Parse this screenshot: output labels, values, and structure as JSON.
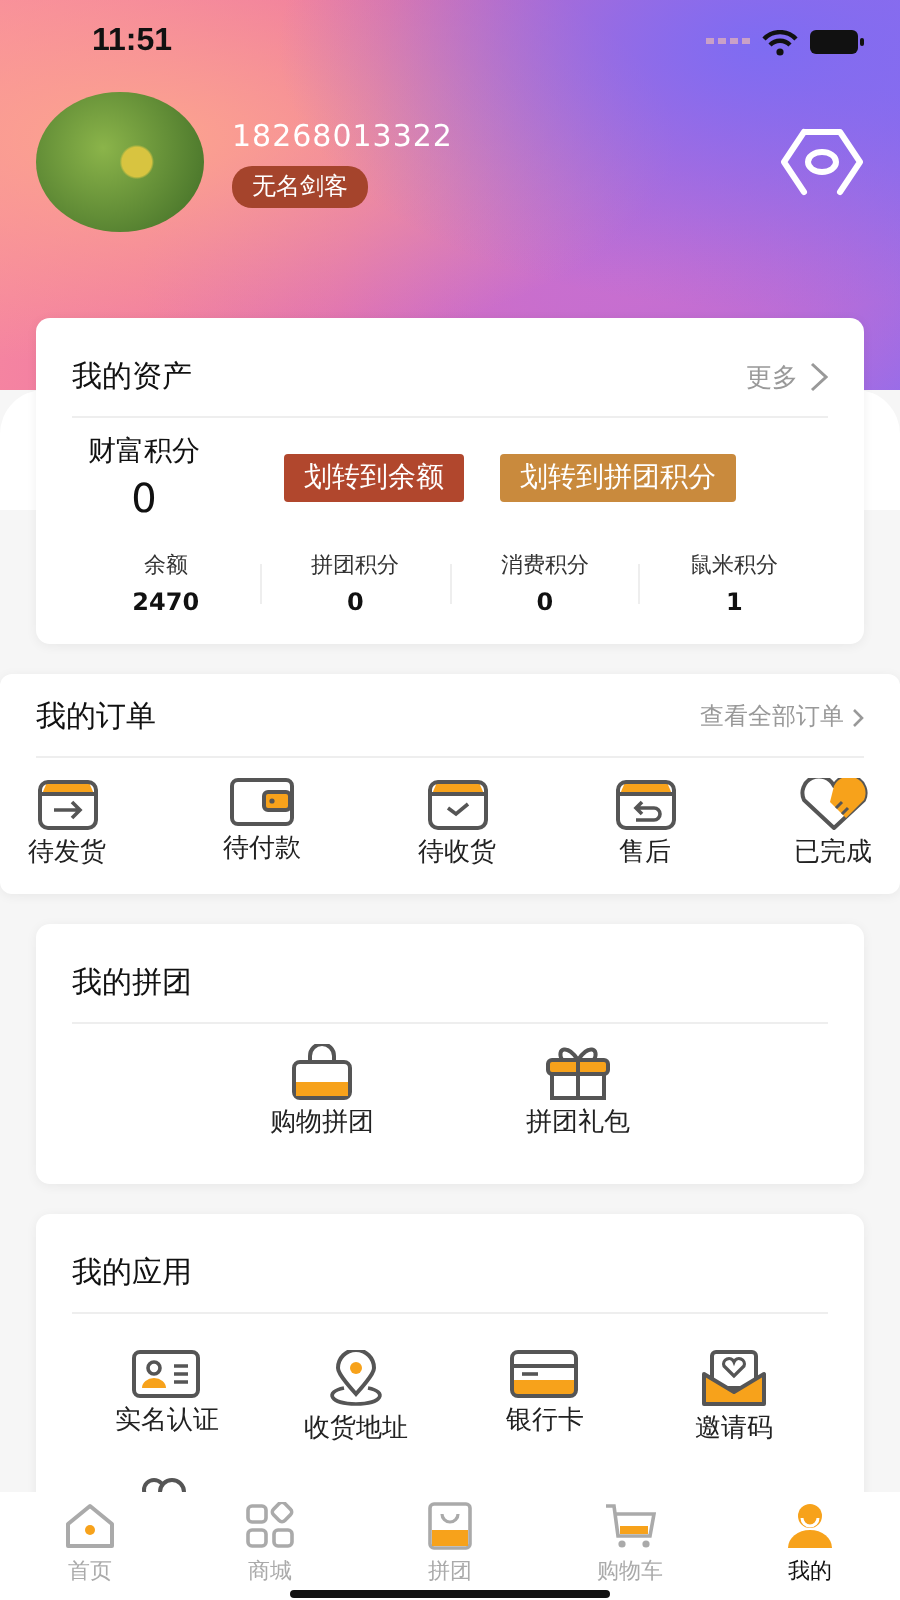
{
  "status_bar": {
    "time": "11:51"
  },
  "profile": {
    "phone": "18268013322",
    "nickname": "无名剑客"
  },
  "assets": {
    "title": "我的资产",
    "more": "更多",
    "points_label": "财富积分",
    "points_value": "0",
    "buttons": [
      "划转到余额",
      "划转到拼团积分"
    ],
    "balances": [
      {
        "label": "余额",
        "value": "2470"
      },
      {
        "label": "拼团积分",
        "value": "0"
      },
      {
        "label": "消费积分",
        "value": "0"
      },
      {
        "label": "鼠米积分",
        "value": "1"
      }
    ]
  },
  "orders": {
    "title": "我的订单",
    "view_all": "查看全部订单",
    "items": [
      "待发货",
      "待付款",
      "待收货",
      "售后",
      "已完成"
    ]
  },
  "group": {
    "title": "我的拼团",
    "items": [
      "购物拼团",
      "拼团礼包"
    ]
  },
  "apps": {
    "title": "我的应用",
    "items": [
      "实名认证",
      "收货地址",
      "银行卡",
      "邀请码"
    ]
  },
  "tab_bar": [
    {
      "label": "首页",
      "selected": false
    },
    {
      "label": "商城",
      "selected": false
    },
    {
      "label": "拼团",
      "selected": false
    },
    {
      "label": "购物车",
      "selected": false
    },
    {
      "label": "我的",
      "selected": true
    }
  ]
}
